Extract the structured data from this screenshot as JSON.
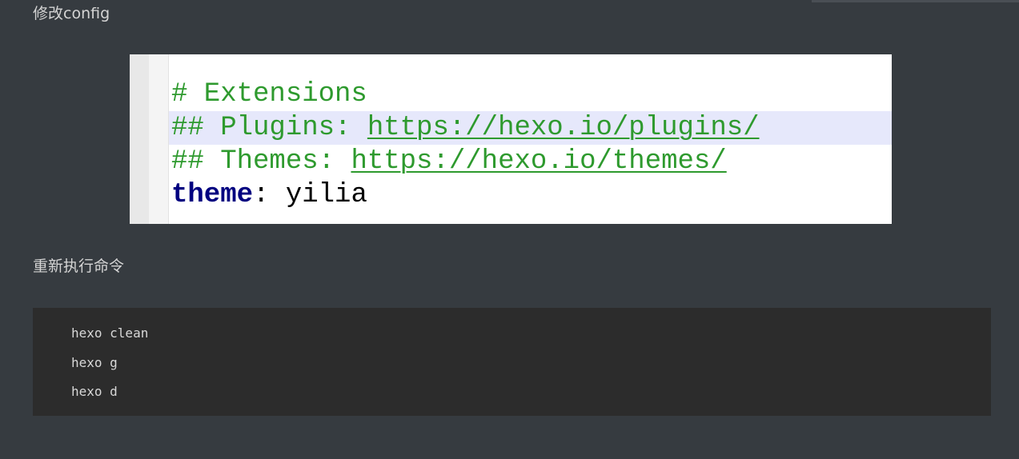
{
  "article": {
    "para_config": "修改config",
    "para_rerun": "重新执行命令"
  },
  "config_screenshot": {
    "line1_comment": "# Extensions",
    "line2_prefix": "## Plugins: ",
    "line2_url": "https://hexo.io/plugins/",
    "line3_prefix": "## Themes: ",
    "line3_url": "https://hexo.io/themes/",
    "line4_key": "theme",
    "line4_colon": ":",
    "line4_value": " yilia"
  },
  "commands": [
    "hexo clean",
    "hexo g",
    "hexo d"
  ],
  "colors": {
    "page_background": "#363b40",
    "comment_green": "#2e9a2e",
    "yaml_key_navy": "#000080",
    "line_highlight": "#e6e8fb",
    "terminal_background": "#2c2c2c"
  }
}
